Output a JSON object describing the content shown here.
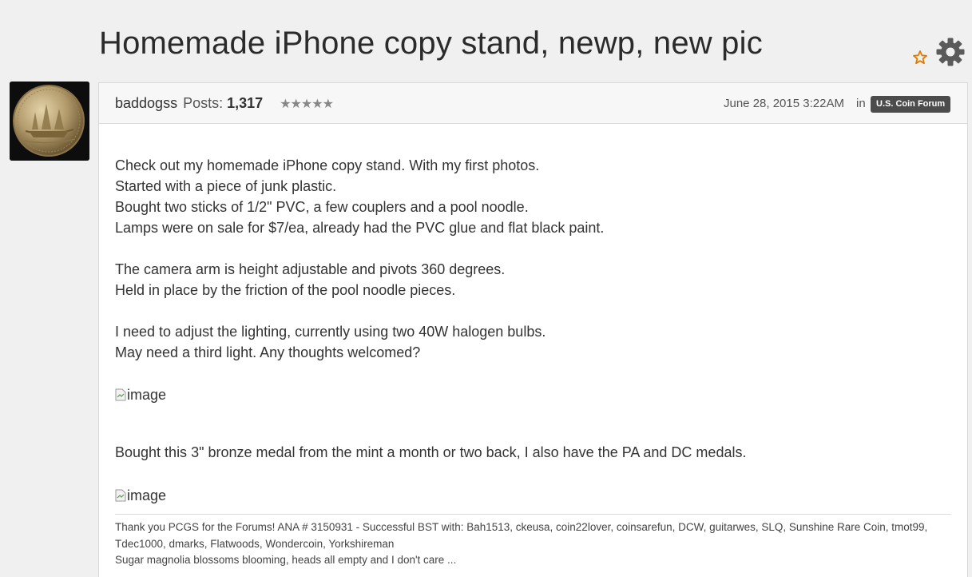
{
  "discussion": {
    "title": "Homemade iPhone copy stand, newp, new pic"
  },
  "icons": {
    "bookmark": "star-outline-icon",
    "options": "gear-icon",
    "accent_color": "#e07b00"
  },
  "post": {
    "author": "baddogss",
    "posts_label": "Posts:",
    "posts_count": "1,317",
    "rank_stars": "★★★★★",
    "date": "June 28, 2015 3:22AM",
    "in_label": "in",
    "category": "U.S. Coin Forum",
    "body": {
      "p1": "Check out my homemade iPhone copy stand. With my first photos.",
      "p2": "Started with a piece of junk plastic.",
      "p3": "Bought two sticks of 1/2\" PVC, a few couplers and a pool noodle.",
      "p4": "Lamps were on sale for $7/ea, already had the PVC glue and flat black paint.",
      "p5": "The camera arm is height adjustable and pivots 360 degrees.",
      "p6": "Held in place by the friction of the pool noodle pieces.",
      "p7": "I need to adjust the lighting, currently using two 40W halogen bulbs.",
      "p8": "May need a third light. Any thoughts welcomed?",
      "image1_alt": "image",
      "p9": "Bought this 3\" bronze medal from the mint a month or two back, I also have the PA and DC medals.",
      "image2_alt": "image"
    },
    "signature": {
      "line1": "Thank you PCGS for the Forums! ANA # 3150931 - Successful BST with: Bah1513, ckeusa, coin22lover, coinsarefun, DCW, guitarwes, SLQ, Sunshine Rare Coin, tmot99, Tdec1000, dmarks, Flatwoods, Wondercoin, Yorkshireman",
      "line2": "Sugar magnolia blossoms blooming, heads all empty and I don't care ..."
    }
  }
}
